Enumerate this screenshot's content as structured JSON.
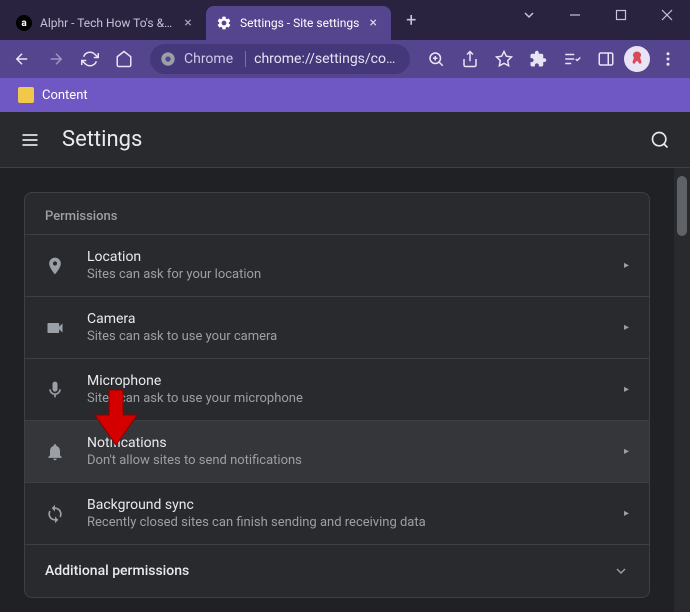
{
  "tabs": [
    {
      "title": "Alphr - Tech How To's & G",
      "favicon": "alphr",
      "active": false
    },
    {
      "title": "Settings - Site settings",
      "favicon": "settings",
      "active": true
    }
  ],
  "bookmarks": [
    {
      "label": "Content"
    }
  ],
  "omnibox": {
    "prefix": "Chrome",
    "url": "chrome://settings/co…"
  },
  "settings_header": {
    "title": "Settings"
  },
  "permissions": {
    "section_label": "Permissions",
    "items": [
      {
        "icon": "location",
        "title": "Location",
        "desc": "Sites can ask for your location",
        "hover": false
      },
      {
        "icon": "camera",
        "title": "Camera",
        "desc": "Sites can ask to use your camera",
        "hover": false
      },
      {
        "icon": "mic",
        "title": "Microphone",
        "desc": "Sites can ask to use your microphone",
        "hover": false
      },
      {
        "icon": "bell",
        "title": "Notifications",
        "desc": "Don't allow sites to send notifications",
        "hover": true
      },
      {
        "icon": "sync",
        "title": "Background sync",
        "desc": "Recently closed sites can finish sending and receiving data",
        "hover": false
      }
    ],
    "additional_label": "Additional permissions"
  }
}
